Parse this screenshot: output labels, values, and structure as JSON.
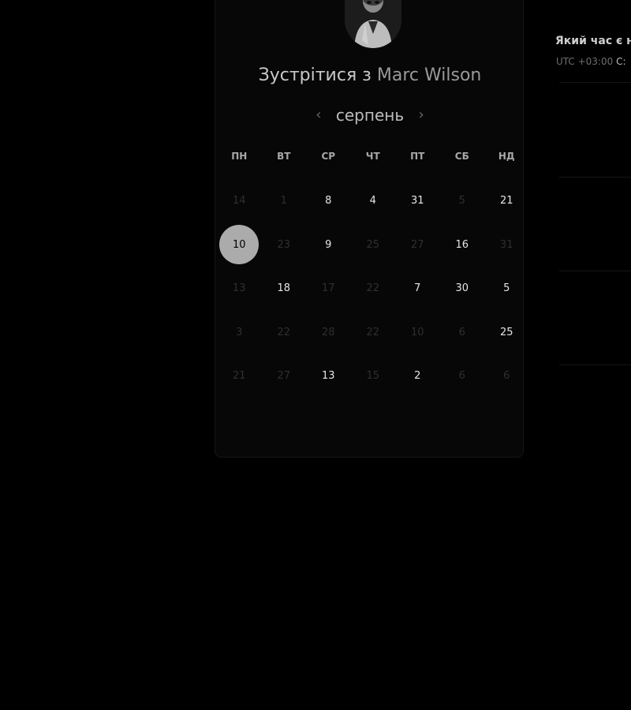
{
  "booking": {
    "title_prefix": "Зустрітися з",
    "host_name": "Marc Wilson",
    "avatar_icon": "user-avatar-icon"
  },
  "calendar": {
    "month": "серпень",
    "prev_icon": "chevron-left-icon",
    "next_icon": "chevron-right-icon",
    "weekdays": [
      "ПН",
      "ВТ",
      "СР",
      "ЧТ",
      "ПТ",
      "СБ",
      "НД"
    ],
    "weeks": [
      [
        "14",
        "1",
        "8",
        "4",
        "31",
        "5",
        "21"
      ],
      [
        "10",
        "23",
        "9",
        "25",
        "27",
        "16",
        "31"
      ],
      [
        "13",
        "18",
        "17",
        "22",
        "7",
        "30",
        "5"
      ],
      [
        "3",
        "22",
        "28",
        "22",
        "10",
        "6",
        "25"
      ],
      [
        "21",
        "27",
        "13",
        "15",
        "2",
        "6",
        "6"
      ]
    ],
    "available": [
      [
        false,
        false,
        true,
        true,
        true,
        false,
        true
      ],
      [
        true,
        false,
        true,
        false,
        false,
        true,
        false
      ],
      [
        false,
        true,
        false,
        false,
        true,
        true,
        true
      ],
      [
        false,
        false,
        false,
        false,
        false,
        false,
        true
      ],
      [
        false,
        false,
        true,
        false,
        true,
        false,
        false
      ]
    ],
    "selected_day": "10"
  },
  "time_panel": {
    "question": "Який час є н",
    "timezone_prefix": "UTC +03:00",
    "timezone_rest": "С:"
  },
  "colors": {
    "background": "#000000",
    "selected_day_bg": "#ababab",
    "available_text": "#e6e6e6",
    "unavailable_text": "#2f2f2f"
  }
}
